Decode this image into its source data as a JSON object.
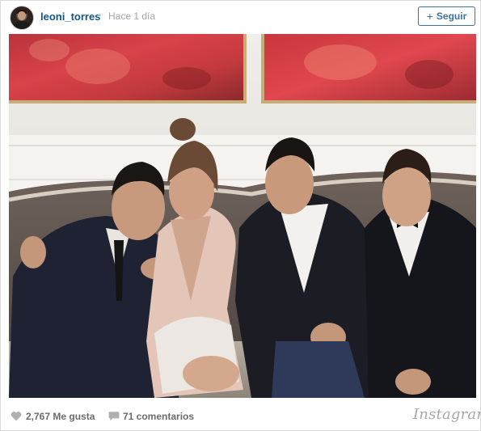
{
  "post": {
    "username": "leoni_torres",
    "separator": "•",
    "time": "Hace 1 día",
    "follow_icon": "+",
    "follow_label": "Seguir"
  },
  "photo": {
    "description_icon": "group-photo"
  },
  "footer": {
    "likes": "2,767 Me gusta",
    "comments": "71 comentarios",
    "brand": "Instagram"
  },
  "colors": {
    "link": "#125688",
    "button": "#3f729b",
    "muted": "#a5a5a5"
  }
}
